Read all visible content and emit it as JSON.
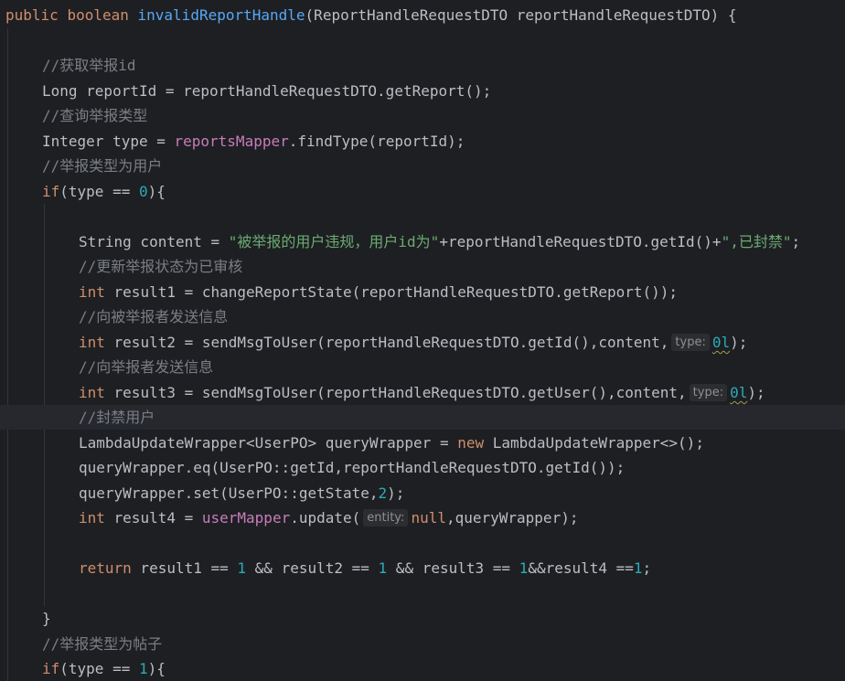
{
  "code": {
    "l1": {
      "kw1": "public",
      "kw2": "boolean",
      "method": "invalidReportHandle",
      "rest": "(ReportHandleRequestDTO reportHandleRequestDTO) {"
    },
    "l3": {
      "comment": "//获取举报id"
    },
    "l4": {
      "text": "Long reportId = reportHandleRequestDTO.getReport();"
    },
    "l5": {
      "comment": "//查询举报类型"
    },
    "l6": {
      "pre": "Integer type = ",
      "field": "reportsMapper",
      "post": ".findType(reportId);"
    },
    "l7": {
      "comment": "//举报类型为用户"
    },
    "l8": {
      "kw": "if",
      "pre": "(type == ",
      "num": "0",
      "post": "){"
    },
    "l10": {
      "pre": "String content = ",
      "str": "\"被举报的用户违规，用户id为\"",
      "mid": "+reportHandleRequestDTO.getId()+",
      "str2": "\",已封禁\"",
      "post": ";"
    },
    "l11": {
      "comment": "//更新举报状态为已审核"
    },
    "l12": {
      "kw": "int",
      "text": " result1 = changeReportState(reportHandleRequestDTO.getReport());"
    },
    "l13": {
      "comment": "//向被举报者发送信息"
    },
    "l14": {
      "kw": "int",
      "text": " result2 = sendMsgToUser(reportHandleRequestDTO.getId(),content,",
      "hint": "type:",
      "val": "0l",
      "post": ");"
    },
    "l15": {
      "comment": "//向举报者发送信息"
    },
    "l16": {
      "kw": "int",
      "text": " result3 = sendMsgToUser(reportHandleRequestDTO.getUser(),content,",
      "hint": "type:",
      "val": "0l",
      "post": ");"
    },
    "l17": {
      "comment": "//封禁用户"
    },
    "l18": {
      "pre": "LambdaUpdateWrapper<UserPO> queryWrapper = ",
      "kw": "new",
      "post": " LambdaUpdateWrapper<>();"
    },
    "l19": {
      "text": "queryWrapper.eq(UserPO::getId,reportHandleRequestDTO.getId());"
    },
    "l20": {
      "pre": "queryWrapper.set(UserPO::getState,",
      "num": "2",
      "post": ");"
    },
    "l21": {
      "kw": "int",
      "pre": " result4 = ",
      "field": "userMapper",
      "mid": ".update(",
      "hint": "entity:",
      "kw2": "null",
      "post": ",queryWrapper);"
    },
    "l23": {
      "kw": "return",
      "a": " result1 == ",
      "n1": "1",
      "b": " && result2 == ",
      "n2": "1",
      "c": " && result3 == ",
      "n3": "1",
      "d": "&&result4 ==",
      "n4": "1",
      "e": ";"
    },
    "l25": {
      "text": "}"
    },
    "l26": {
      "comment": "//举报类型为帖子"
    },
    "l27": {
      "kw": "if",
      "pre": "(type == ",
      "num": "1",
      "post": "){"
    }
  }
}
